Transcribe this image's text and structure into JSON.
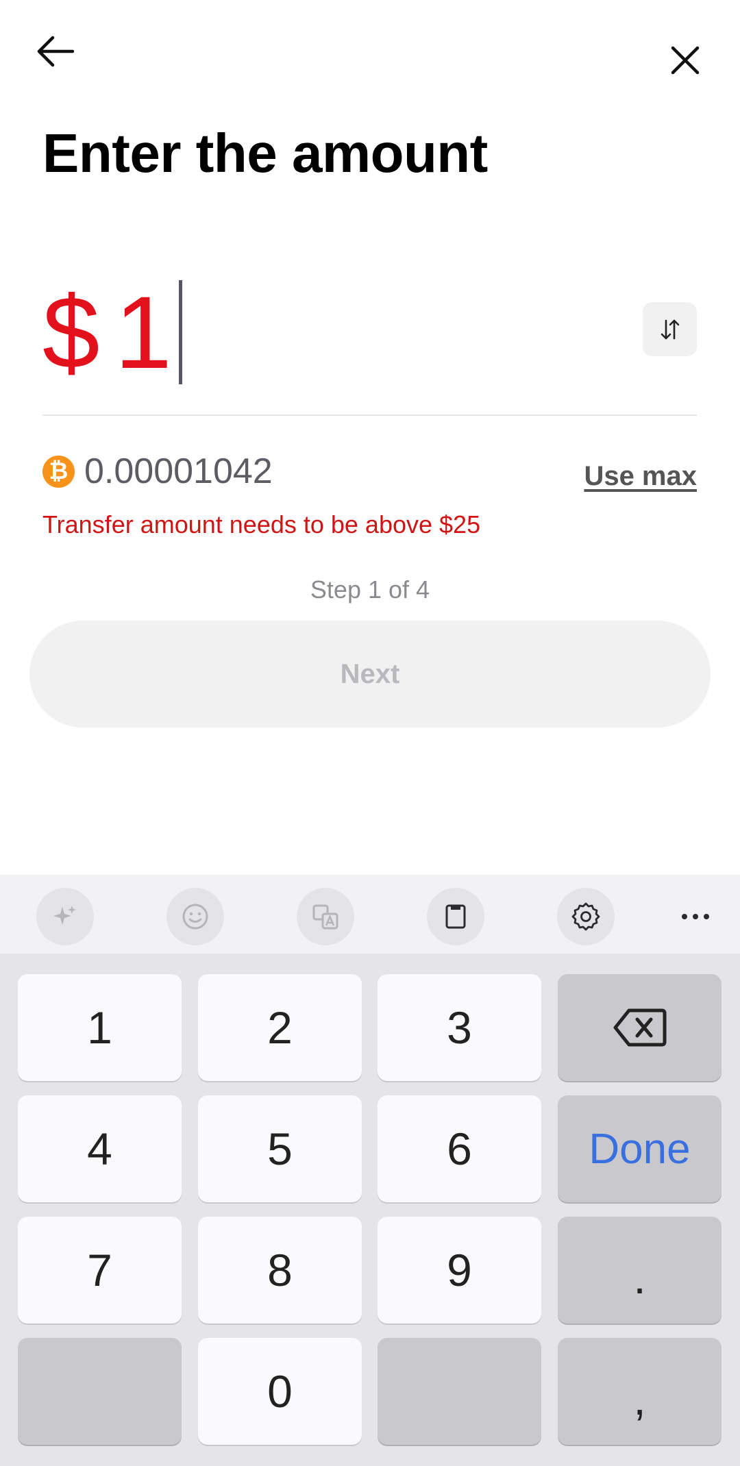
{
  "header": {
    "back_icon": "arrow-left-icon",
    "close_icon": "close-icon",
    "title": "Enter the amount"
  },
  "amount": {
    "currency_symbol": "$",
    "value": "1",
    "color": "#e3111b",
    "swap_icon": "swap-vertical-icon"
  },
  "conversion": {
    "coin_icon": "bitcoin-icon",
    "coin_symbol": "₿",
    "btc_value": "0.00001042",
    "use_max_label": "Use max"
  },
  "error_text": "Transfer amount needs to be above $25",
  "step_text": "Step 1 of 4",
  "next_label": "Next",
  "keyboard": {
    "toolbar_icons": [
      "sparkle-icon",
      "emoji-icon",
      "translate-icon",
      "clipboard-icon",
      "gear-icon",
      "more-icon"
    ],
    "keys": {
      "k1": "1",
      "k2": "2",
      "k3": "3",
      "k4": "4",
      "k5": "5",
      "k6": "6",
      "k7": "7",
      "k8": "8",
      "k9": "9",
      "k0": "0",
      "done": "Done",
      "period": ".",
      "comma": ","
    },
    "backspace_icon": "backspace-icon"
  }
}
